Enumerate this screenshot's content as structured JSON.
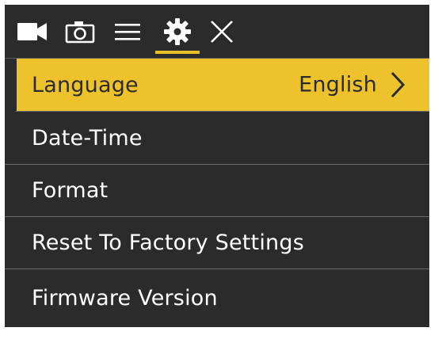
{
  "colors": {
    "screen_bg": "#2b2b2b",
    "accent": "#eec22c",
    "text": "#ffffff",
    "selected_text": "#2b2b2b",
    "divider": "#6b6b6b"
  },
  "topbar": {
    "tabs": [
      {
        "icon": "video-camera-icon"
      },
      {
        "icon": "photo-camera-icon"
      },
      {
        "icon": "menu-lines-icon"
      },
      {
        "icon": "gear-icon",
        "active": true
      },
      {
        "icon": "close-icon"
      }
    ]
  },
  "menu": {
    "items": [
      {
        "label": "Language",
        "value": "English",
        "selected": true
      },
      {
        "label": "Date-Time"
      },
      {
        "label": "Format"
      },
      {
        "label": "Reset To Factory Settings"
      },
      {
        "label": "Firmware Version"
      }
    ]
  }
}
